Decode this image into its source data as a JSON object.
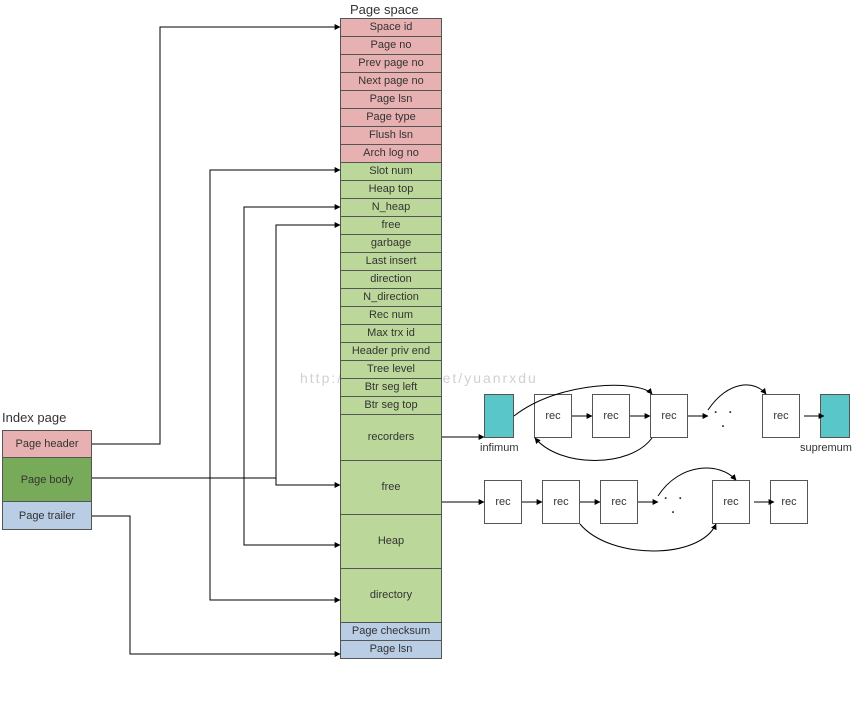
{
  "titles": {
    "index_page": "Index page",
    "page_space": "Page space"
  },
  "index_page": {
    "header": "Page header",
    "body": "Page body",
    "trailer": "Page trailer"
  },
  "page_space": {
    "header": [
      "Space id",
      "Page no",
      "Prev page no",
      "Next page no",
      "Page lsn",
      "Page type",
      "Flush lsn",
      "Arch log no"
    ],
    "body_meta": [
      "Slot num",
      "Heap top",
      "N_heap",
      "free",
      "garbage",
      "Last insert",
      "direction",
      "N_direction",
      "Rec num",
      "Max trx id",
      "Header priv end",
      "Tree level",
      "Btr seg left",
      "Btr seg top"
    ],
    "body_blocks": [
      "recorders",
      "free",
      "Heap",
      "directory"
    ],
    "trailer": [
      "Page checksum",
      "Page lsn"
    ]
  },
  "rec_rows": {
    "rec_label": "rec",
    "dots": ". . .",
    "infimum": "infimum",
    "supremum": "supremum"
  },
  "watermark": "http://blog.csdn.net/yuanrxdu"
}
